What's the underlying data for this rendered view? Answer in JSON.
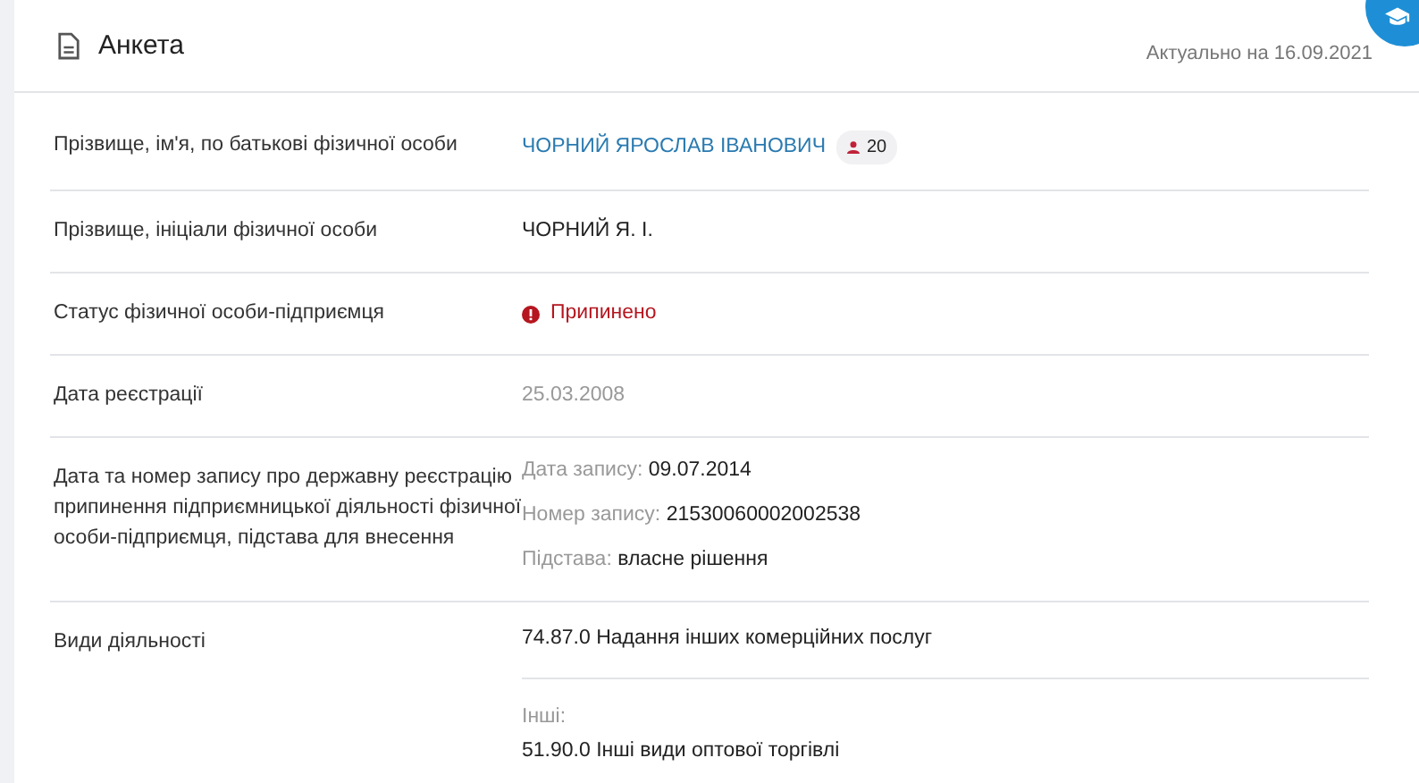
{
  "header": {
    "title": "Анкета",
    "updated": "Актуально на 16.09.2021"
  },
  "rows": [
    {
      "kind": "link",
      "label": "Прізвище, ім'я, по батькові фізичної особи",
      "value": "ЧОРНИЙ ЯРОСЛАВ ІВАНОВИЧ",
      "count": "20"
    },
    {
      "kind": "text",
      "label": "Прізвище, ініціали фізичної особи",
      "value": "ЧОРНИЙ Я. І."
    },
    {
      "kind": "status",
      "label": "Статус фізичної особи-підприємця",
      "value": "Припинено"
    },
    {
      "kind": "muted",
      "label": "Дата реєстрації",
      "value": "25.03.2008"
    },
    {
      "kind": "records",
      "label": "Дата та номер запису про державну реєстрацію припинення підприємницької діяльності фізичної особи-підприємця, підстава для внесення",
      "items": [
        {
          "name": "Дата запису:",
          "value": "09.07.2014"
        },
        {
          "name": "Номер запису:",
          "value": "21530060002002538"
        },
        {
          "name": "Підстава:",
          "value": "власне рішення"
        }
      ]
    },
    {
      "kind": "activities",
      "label": "Види діяльності",
      "main": "74.87.0 Надання інших комерційних послуг",
      "others_label": "Інші:",
      "others": [
        "51.90.0 Інші види оптової торгівлі"
      ]
    }
  ]
}
